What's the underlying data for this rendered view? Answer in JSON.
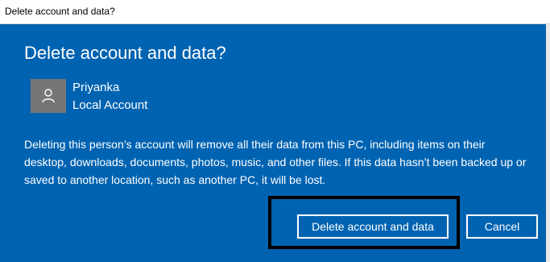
{
  "window": {
    "title": "Delete account and data?"
  },
  "dialog": {
    "heading": "Delete account and data?",
    "user": {
      "name": "Priyanka",
      "account_type": "Local Account",
      "avatar_icon": "person-icon"
    },
    "description": "Deleting this person’s account will remove all their data from this PC, including items on their desktop, downloads, documents, photos, music, and other files. If this data hasn’t been backed up or saved to another location, such as another PC, it will be lost.",
    "buttons": {
      "delete_label": "Delete account and data",
      "cancel_label": "Cancel"
    }
  },
  "colors": {
    "dialog_background": "#0063b1",
    "avatar_background": "#767676",
    "text": "#ffffff",
    "highlight_border": "#000000"
  }
}
